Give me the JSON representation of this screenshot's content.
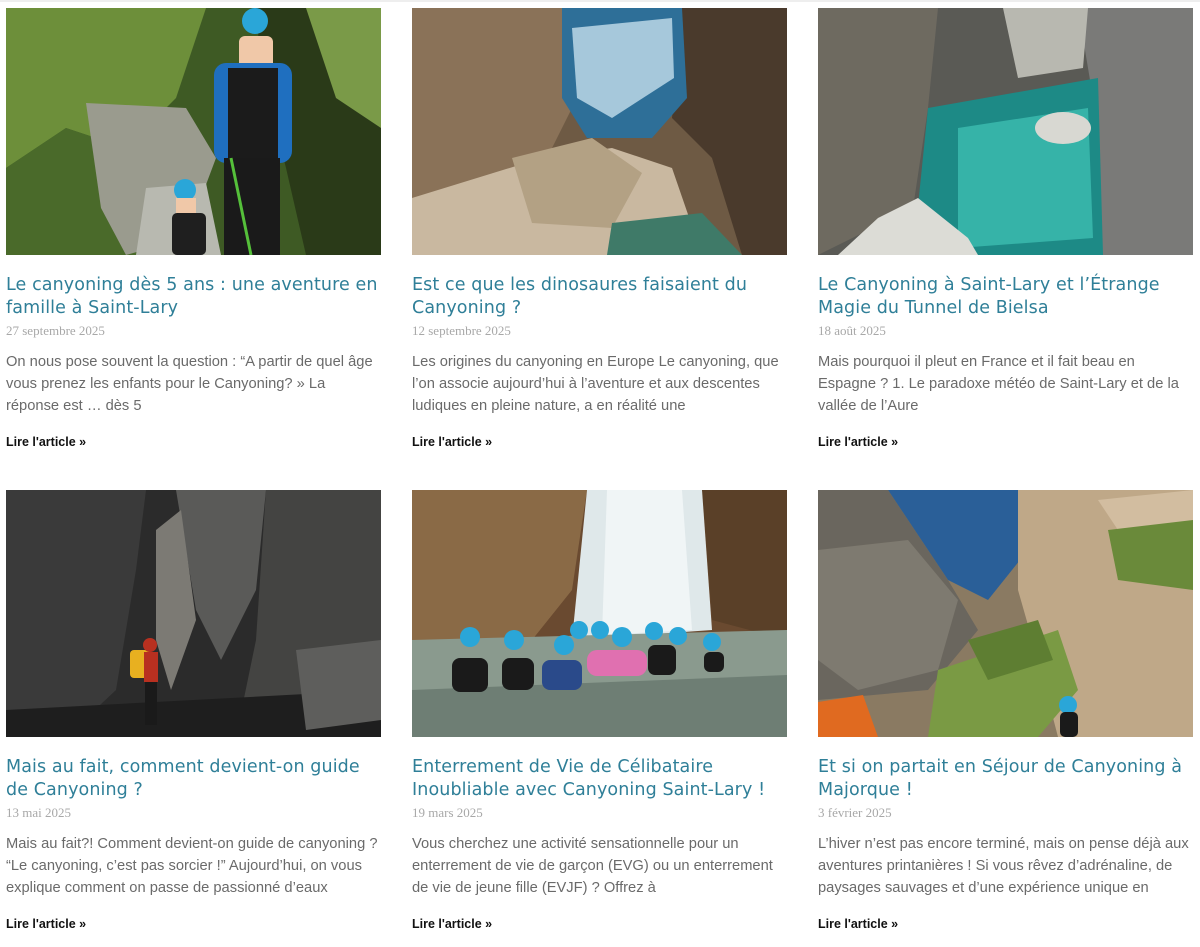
{
  "posts": [
    {
      "title": "Le canyoning dès 5 ans : une aventure en famille à Saint-Lary",
      "date": "27 septembre 2025",
      "excerpt": "On nous pose souvent la question : “A partir de quel âge vous prenez les enfants pour le Canyoning? » La réponse est … dès 5",
      "read_more": "Lire l'article »",
      "image_alt": "kids-rappelling-photo"
    },
    {
      "title": "Est ce que les dinosaures faisaient du Canyoning ?",
      "date": "12 septembre 2025",
      "excerpt": "Les origines du canyoning en Europe Le canyoning, que l’on associe aujourd’hui à l’aventure et aux descentes ludiques en pleine nature, a en réalité une",
      "read_more": "Lire l'article »",
      "image_alt": "rock-pothole-photo"
    },
    {
      "title": "Le Canyoning à Saint-Lary et l’Étrange Magie du Tunnel de Bielsa",
      "date": "18 août 2025",
      "excerpt": "Mais pourquoi il pleut en France et il fait beau en Espagne ? 1. Le paradoxe météo de Saint-Lary et de la vallée de l’Aure",
      "read_more": "Lire l'article »",
      "image_alt": "turquoise-gorge-photo"
    },
    {
      "title": "Mais au fait, comment devient-on guide de Canyoning ?",
      "date": "13 mai 2025",
      "excerpt": "Mais au fait?! Comment devient-on guide de canyoning ? “Le canyoning, c’est pas sorcier !” Aujourd’hui, on vous explique comment on passe de passionné d’eaux",
      "read_more": "Lire l'article »",
      "image_alt": "dark-canyon-photo"
    },
    {
      "title": "Enterrement de Vie de Célibataire Inoubliable avec Canyoning Saint-Lary !",
      "date": "19 mars 2025",
      "excerpt": "Vous cherchez une activité sensationnelle pour un enterrement de vie de garçon (EVG) ou un enterrement de vie de jeune fille (EVJF) ? Offrez à",
      "read_more": "Lire l'article »",
      "image_alt": "group-waterfall-photo"
    },
    {
      "title": "Et si on partait en Séjour de Canyoning à Majorque !",
      "date": "3 février 2025",
      "excerpt": "L’hiver n’est pas encore terminé, mais on pense déjà aux aventures printanières ! Si vous rêvez d’adrénaline, de paysages sauvages et d’une expérience unique en",
      "read_more": "Lire l'article »",
      "image_alt": "majorca-cliffs-photo"
    }
  ],
  "colors": {
    "title": "#2f7f98",
    "date": "#a8a8a8",
    "excerpt": "#6a6a6a",
    "read_more": "#111111"
  }
}
